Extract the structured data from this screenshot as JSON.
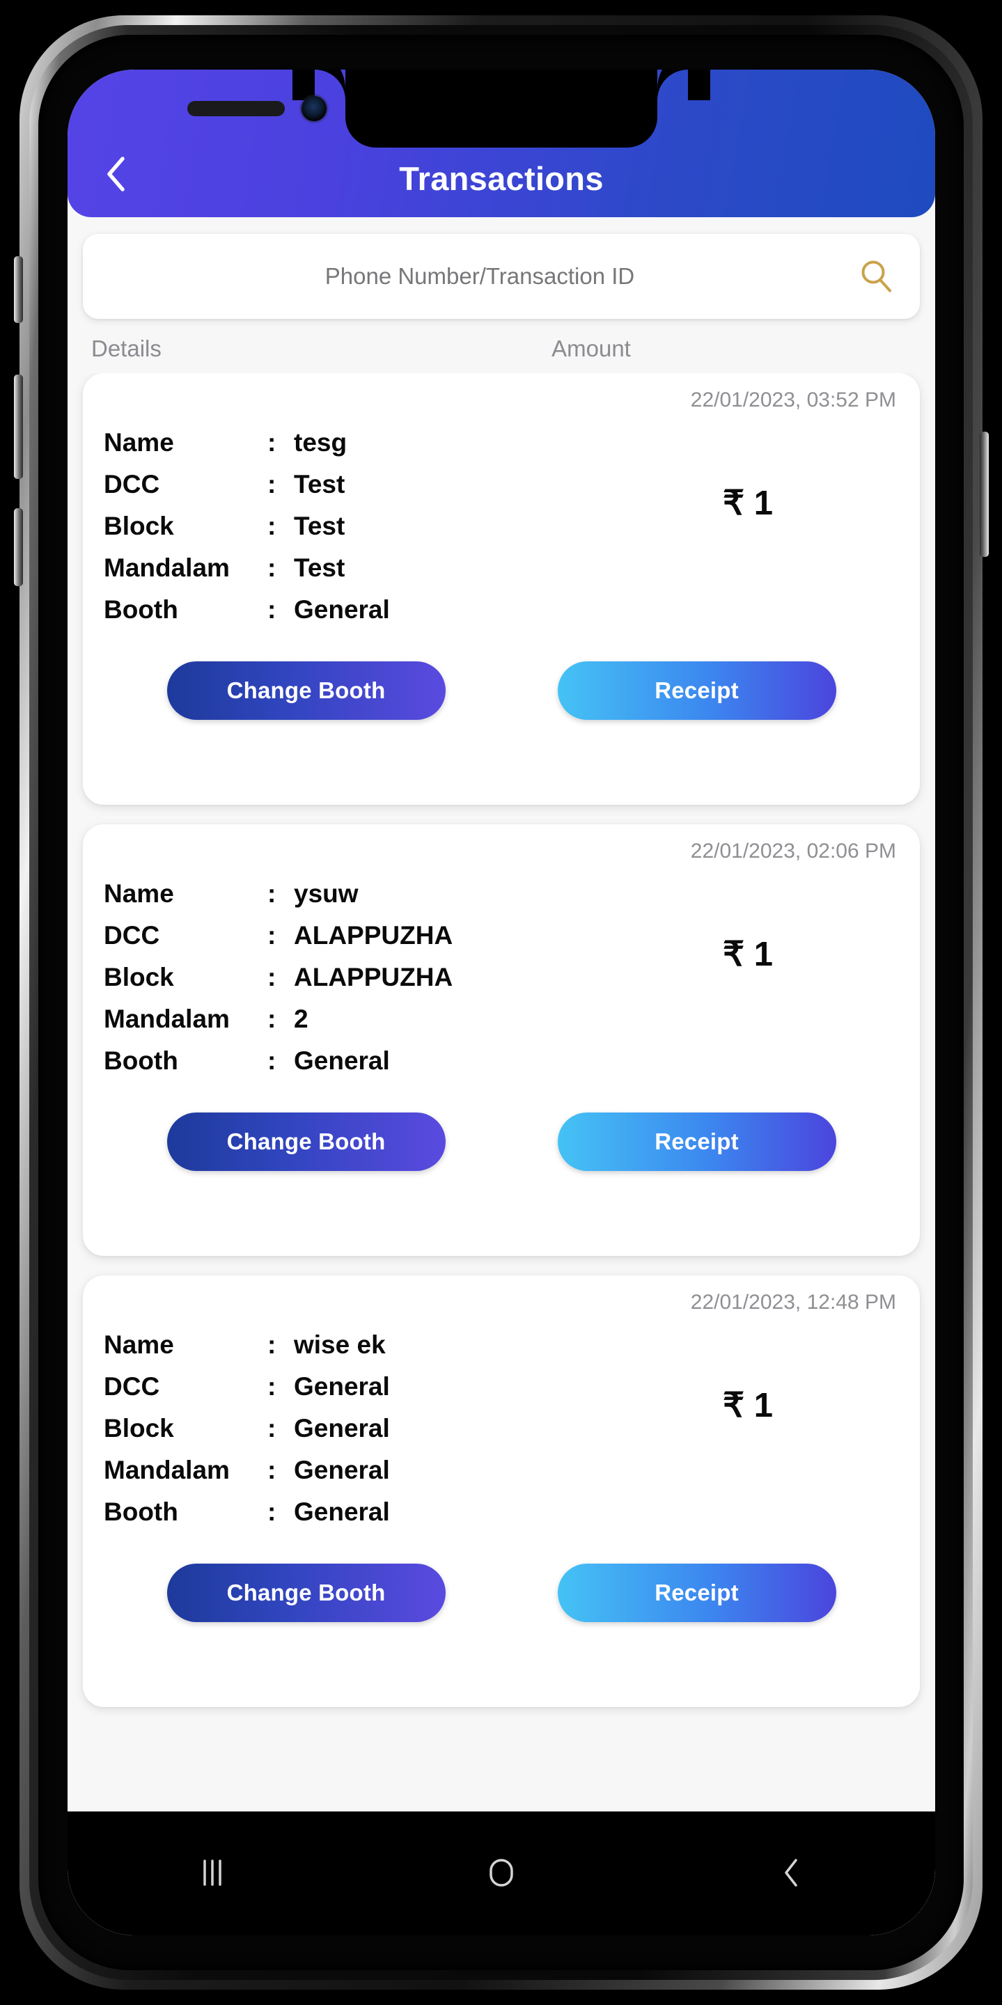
{
  "app": {
    "header": {
      "title": "Transactions",
      "back_icon": "chevron-left-icon",
      "gradient_from": "#5544e6",
      "gradient_to": "#1f4bbf"
    },
    "search": {
      "placeholder": "Phone Number/Transaction ID",
      "value": "",
      "icon": "search-icon",
      "icon_color": "#c9a24a"
    },
    "columns": {
      "details": "Details",
      "amount": "Amount"
    },
    "field_labels": {
      "name": "Name",
      "dcc": "DCC",
      "block": "Block",
      "mandalam": "Mandalam",
      "booth": "Booth",
      "colon": ":"
    },
    "buttons": {
      "change_booth": "Change Booth",
      "receipt": "Receipt",
      "change_booth_gradient_from": "#1e3a9b",
      "change_booth_gradient_to": "#5a4ae0",
      "receipt_gradient_from": "#45c2f5",
      "receipt_gradient_to": "#4b45dd"
    },
    "transactions": [
      {
        "date": "22/01/2023, 03:52 PM",
        "name": "tesg",
        "dcc": "Test",
        "block": "Test",
        "mandalam": "Test",
        "booth": "General",
        "amount": "₹ 1"
      },
      {
        "date": "22/01/2023, 02:06 PM",
        "name": "ysuw",
        "dcc": "ALAPPUZHA",
        "block": "ALAPPUZHA",
        "mandalam": "2",
        "booth": "General",
        "amount": "₹ 1"
      },
      {
        "date": "22/01/2023, 12:48 PM",
        "name": "wise ek",
        "dcc": "General",
        "block": "General",
        "mandalam": "General",
        "booth": "General",
        "amount": "₹ 1"
      }
    ]
  },
  "system_nav": {
    "recents_icon": "recents-icon",
    "home_icon": "home-icon",
    "back_icon": "back-icon"
  }
}
